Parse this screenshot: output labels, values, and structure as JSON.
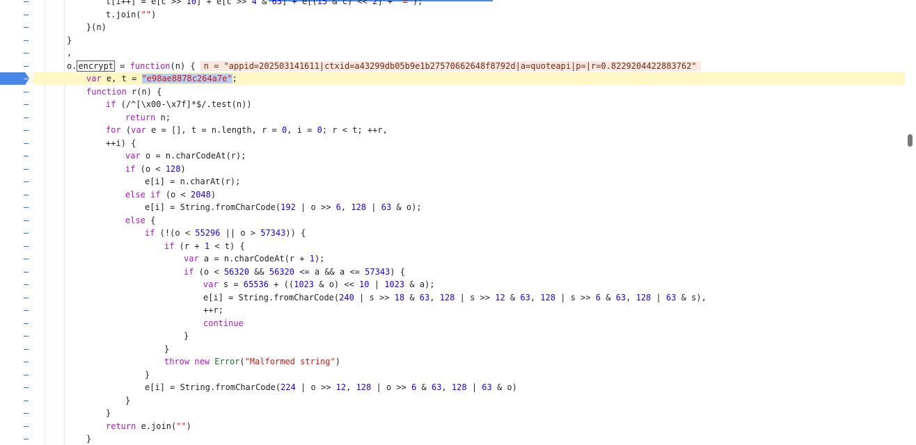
{
  "lines": [
    {
      "t": "t[i++] = e[c >> 10] + e[c >> 4 & 63] + e[(15 & c) << 2] + \"=\");",
      "indent": 6
    },
    {
      "t": "t.join(\"\")",
      "indent": 6
    },
    {
      "t": "}(n)",
      "indent": 4
    },
    {
      "t": "}",
      "indent": 2
    },
    {
      "t": ",",
      "indent": 2
    },
    {
      "t": "o.encrypt = function(n) {",
      "indent": 2
    },
    {
      "t": "var e, t = \"e98ae8878c264a7e\";",
      "indent": 4
    },
    {
      "t": "function r(n) {",
      "indent": 4
    },
    {
      "t": "if (/^[\\x00-\\x7f]*$/.test(n))",
      "indent": 6
    },
    {
      "t": "return n;",
      "indent": 8
    },
    {
      "t": "for (var e = [], t = n.length, r = 0, i = 0; r < t; ++r,",
      "indent": 6
    },
    {
      "t": "++i) {",
      "indent": 6
    },
    {
      "t": "var o = n.charCodeAt(r);",
      "indent": 8
    },
    {
      "t": "if (o < 128)",
      "indent": 8
    },
    {
      "t": "e[i] = n.charAt(r);",
      "indent": 10
    },
    {
      "t": "else if (o < 2048)",
      "indent": 8
    },
    {
      "t": "e[i] = String.fromCharCode(192 | o >> 6, 128 | 63 & o);",
      "indent": 10
    },
    {
      "t": "else {",
      "indent": 8
    },
    {
      "t": "if (!(o < 55296 || o > 57343)) {",
      "indent": 10
    },
    {
      "t": "if (r + 1 < t) {",
      "indent": 12
    },
    {
      "t": "var a = n.charCodeAt(r + 1);",
      "indent": 14
    },
    {
      "t": "if (o < 56320 && 56320 <= a && a <= 57343) {",
      "indent": 14
    },
    {
      "t": "var s = 65536 + ((1023 & o) << 10 | 1023 & a);",
      "indent": 16
    },
    {
      "t": "e[i] = String.fromCharCode(240 | s >> 18 & 63, 128 | s >> 12 & 63, 128 | s >> 6 & 63, 128 | 63 & s),",
      "indent": 16
    },
    {
      "t": "++r;",
      "indent": 16
    },
    {
      "t": "continue",
      "indent": 16
    },
    {
      "t": "}",
      "indent": 14
    },
    {
      "t": "}",
      "indent": 12
    },
    {
      "t": "throw new Error(\"Malformed string\")",
      "indent": 12
    },
    {
      "t": "}",
      "indent": 10
    },
    {
      "t": "e[i] = String.fromCharCode(224 | o >> 12, 128 | o >> 6 & 63, 128 | 63 & o)",
      "indent": 10
    },
    {
      "t": "}",
      "indent": 8
    },
    {
      "t": "}",
      "indent": 6
    },
    {
      "t": "return e.join(\"\")",
      "indent": 6
    },
    {
      "t": "}",
      "indent": 4
    }
  ],
  "inline_value": "n = \"appid=202503141611|ctxid=a43299db05b9e1b27570662648f8792d|a=quoteapi|p=|r=0.8229204422883762\"",
  "active_line_index": 6,
  "breakpoint_line_index": 6,
  "selected_text": "\"e98ae8878c264a7e\"",
  "colors": {
    "breakpoint": "#4a86e8",
    "active_line": "#fff8c4",
    "selection": "#b9cdf0"
  }
}
